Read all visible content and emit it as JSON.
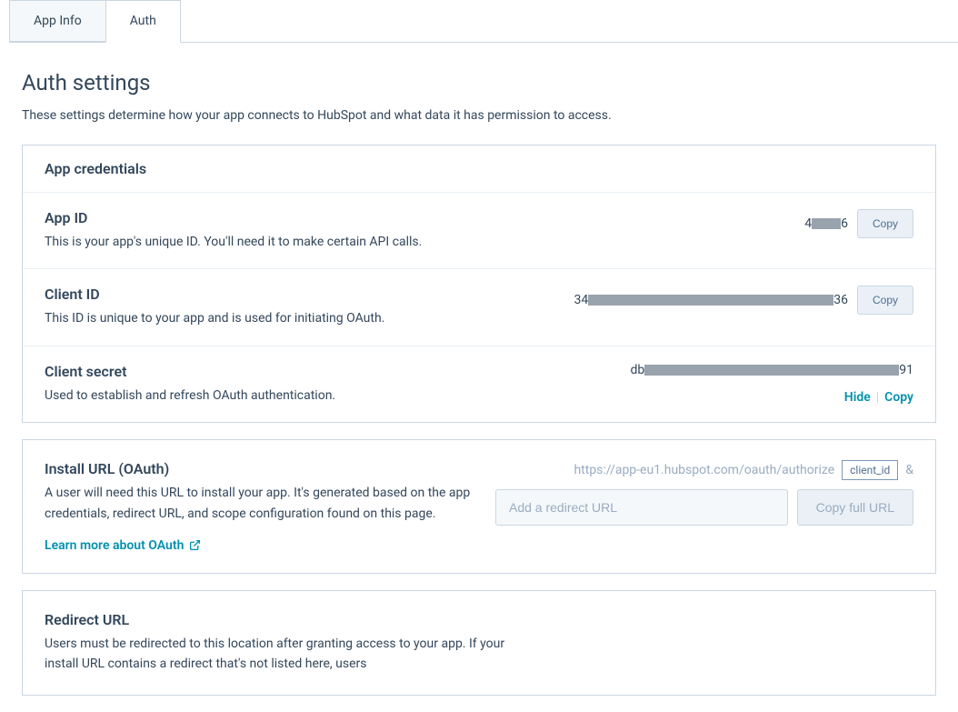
{
  "tabs": {
    "app_info": "App Info",
    "auth": "Auth"
  },
  "page": {
    "title": "Auth settings",
    "description": "These settings determine how your app connects to HubSpot and what data it has permission to access."
  },
  "credentials": {
    "header": "App credentials",
    "app_id": {
      "label": "App ID",
      "desc": "This is your app's unique ID. You'll need it to make certain API calls.",
      "value_prefix": "4",
      "value_suffix": "6",
      "copy": "Copy"
    },
    "client_id": {
      "label": "Client ID",
      "desc": "This ID is unique to your app and is used for initiating OAuth.",
      "value_prefix": "34",
      "value_suffix": "36",
      "copy": "Copy"
    },
    "client_secret": {
      "label": "Client secret",
      "desc": "Used to establish and refresh OAuth authentication.",
      "value_prefix": "db",
      "value_suffix": "91",
      "hide": "Hide",
      "copy": "Copy"
    }
  },
  "install_url": {
    "label": "Install URL (OAuth)",
    "desc": "A user will need this URL to install your app. It's generated based on the app credentials, redirect URL, and scope configuration found on this page.",
    "learn_more": "Learn more about OAuth",
    "url_base": "https://app-eu1.hubspot.com/oauth/authorize",
    "chip_client_id": "client_id",
    "amp": "&",
    "redirect_placeholder": "Add a redirect URL",
    "copy_full": "Copy full URL"
  },
  "redirect_url": {
    "label": "Redirect URL",
    "desc": "Users must be redirected to this location after granting access to your app. If your install URL contains a redirect that's not listed here, users"
  }
}
